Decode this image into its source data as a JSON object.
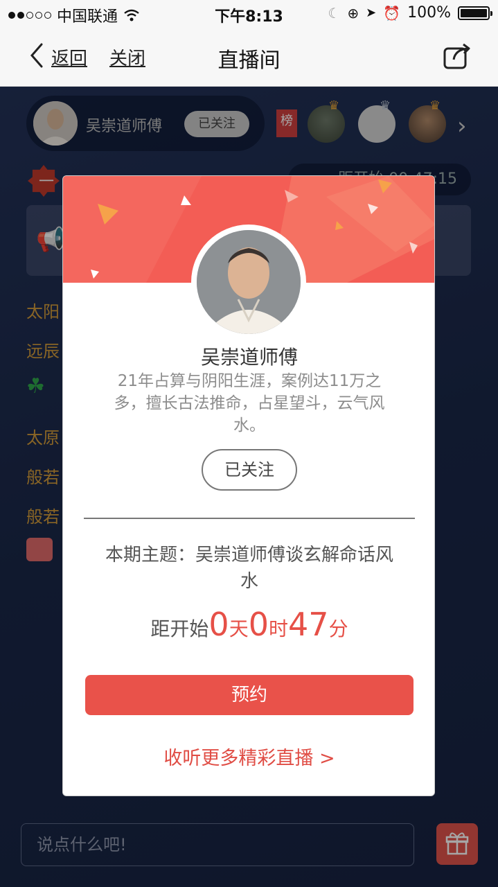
{
  "status_bar": {
    "carrier": "中国联通",
    "time": "下午8:13",
    "battery": "100%"
  },
  "nav": {
    "back_label": "返回",
    "close_label": "关闭",
    "title": "直播间"
  },
  "room": {
    "host_name": "吴崇道师傅",
    "host_follow_label": "已关注",
    "rank_label": "榜",
    "level_label": "一",
    "timer_partial": "距开始 00:47:15",
    "chat_lines": [
      "太阳",
      "远辰",
      "太原",
      "般若",
      "般若"
    ],
    "chat_input_placeholder": "说点什么吧!"
  },
  "modal": {
    "name": "吴崇道师傅",
    "description": "21年占算与阴阳生涯，案例达11万之多，擅长古法推命，占星望斗，云气风水。",
    "follow_label": "已关注",
    "topic": "本期主题：吴崇道师傅谈玄解命话风水",
    "countdown": {
      "prefix": "距开始",
      "days": "0",
      "days_unit": "天",
      "hours": "0",
      "hours_unit": "时",
      "minutes": "47",
      "minutes_unit": "分"
    },
    "reserve_label": "预约",
    "more_label": "收听更多精彩直播 >"
  },
  "colors": {
    "accent_red": "#e9524a",
    "header_red": "#f25b54",
    "bg_navy": "#1d2a4c"
  }
}
